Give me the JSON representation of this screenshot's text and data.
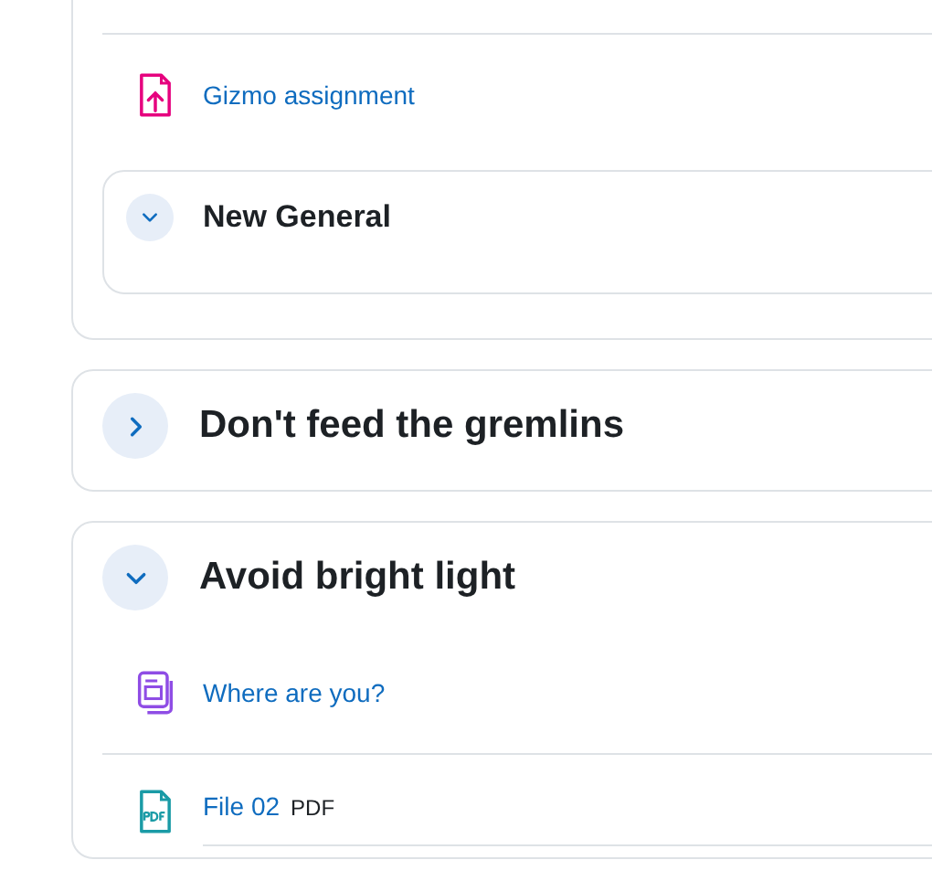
{
  "sections": [
    {
      "activities": [
        {
          "kind": "assignment",
          "name": "Gizmo assignment"
        }
      ],
      "subsections": [
        {
          "title": "New General",
          "expanded": true
        }
      ]
    },
    {
      "title": "Don't feed the gremlins",
      "expanded": false
    },
    {
      "title": "Avoid bright light",
      "expanded": true,
      "activities": [
        {
          "kind": "page",
          "name": "Where are you?"
        },
        {
          "kind": "file",
          "name": "File 02",
          "type_label": "PDF"
        }
      ]
    }
  ]
}
